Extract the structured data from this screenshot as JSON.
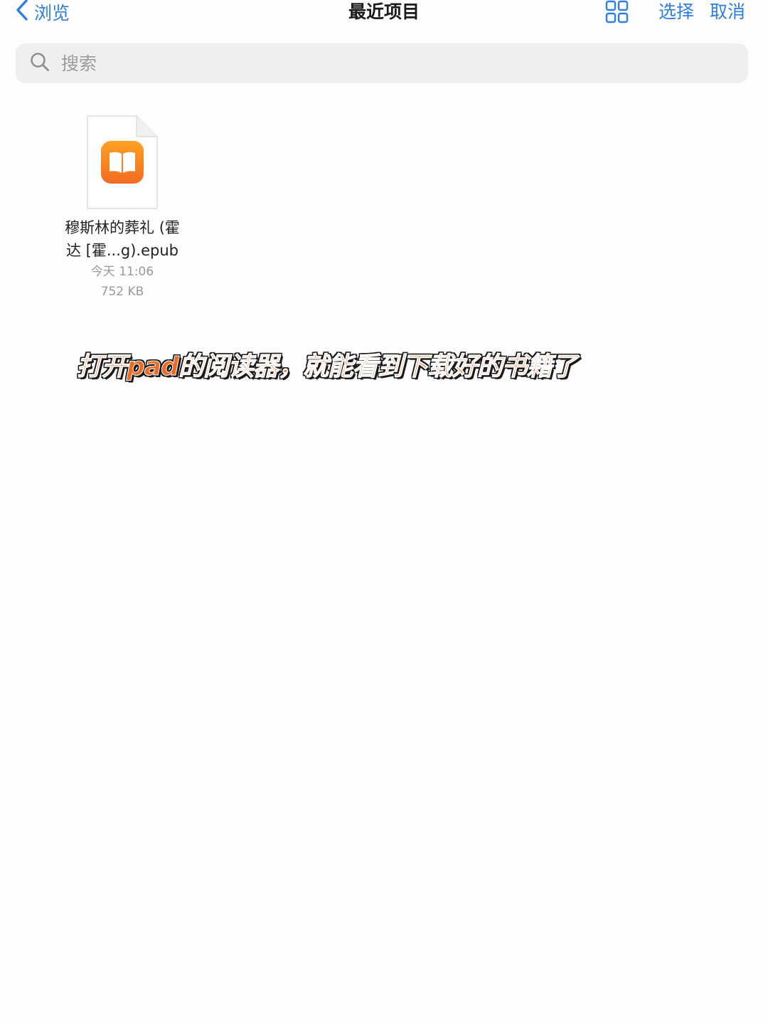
{
  "nav": {
    "back_label": "浏览",
    "title": "最近项目",
    "grid_icon": "grid-view-icon",
    "select_label": "选择",
    "cancel_label": "取消"
  },
  "search": {
    "placeholder": "搜索",
    "icon": "search-icon"
  },
  "files": [
    {
      "name_line1": "穆斯林的葬礼 (霍",
      "name_line2": "达 [霍...g).epub",
      "date": "今天 11:06",
      "size": "752 KB",
      "icon": "books-app-icon"
    }
  ],
  "caption": "打开pad的阅读器，就能看到下载好的书籍了",
  "colors": {
    "accent": "#2f7fe0",
    "caption": "#f26a21",
    "books_orange_top": "#ffa224",
    "books_orange_bottom": "#f26a21"
  }
}
